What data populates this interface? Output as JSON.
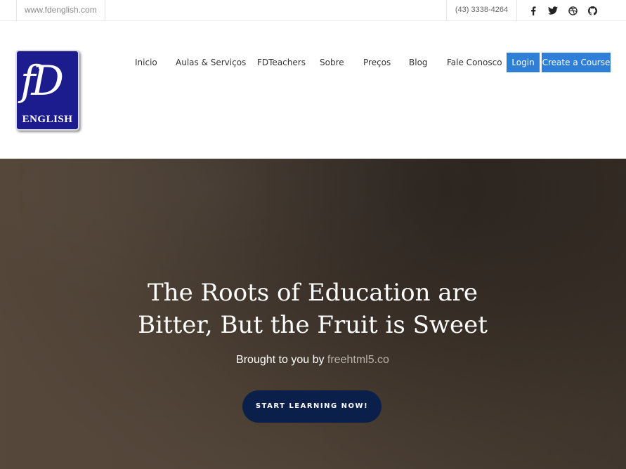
{
  "topbar": {
    "site_url": "www.fdenglish.com",
    "phone": "(43) 3338-4264",
    "social": [
      "facebook-icon",
      "twitter-icon",
      "dribbble-icon",
      "github-icon"
    ]
  },
  "logo": {
    "monogram": "fD",
    "text": "ENGLISH",
    "background_color": "#1c1c8e"
  },
  "nav": {
    "items": [
      "Inicio",
      "Aulas & Serviços",
      "FDTeachers",
      "Sobre",
      "Preços",
      "Blog",
      "Fale Conosco"
    ],
    "login_label": "Login",
    "create_label": "Create a Course",
    "button_color": "#2f7fd8"
  },
  "hero": {
    "title_line1": "The Roots of Education are",
    "title_line2": "Bitter, But the Fruit is Sweet",
    "subtitle_prefix": "Brought to you by ",
    "subtitle_link": "freehtml5.co",
    "cta_label": "START LEARNING NOW!",
    "cta_color": "#0b1f4b"
  }
}
